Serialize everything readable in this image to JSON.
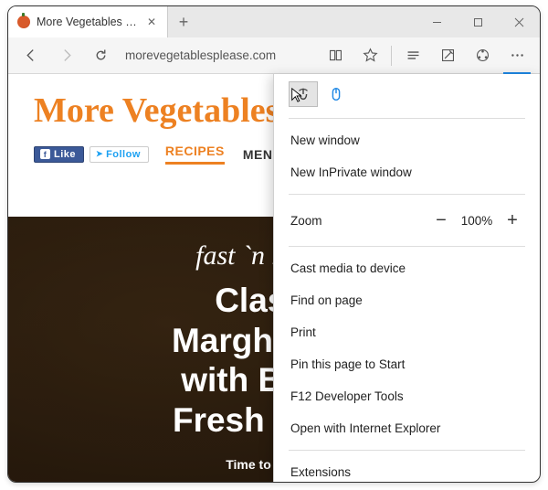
{
  "window": {
    "tab_title": "More Vegetables Please",
    "address": "morevegetablesplease.com"
  },
  "site": {
    "logo_text": "More Vegetables P",
    "fb_label": "Like",
    "tw_label": "Follow",
    "nav": [
      "RECIPES",
      "MENUS"
    ],
    "hero_tag": "fast `n healthy",
    "hero_lines": [
      "Classic",
      "Margherita P",
      "with Basil a",
      "Fresh Mozza"
    ],
    "prep_label": "Time to Prepare"
  },
  "menu": {
    "new_window": "New window",
    "new_inprivate": "New InPrivate window",
    "zoom_label": "Zoom",
    "zoom_value": "100%",
    "cast": "Cast media to device",
    "find": "Find on page",
    "print": "Print",
    "pin": "Pin this page to Start",
    "devtools": "F12 Developer Tools",
    "open_ie": "Open with Internet Explorer",
    "extensions": "Extensions"
  }
}
